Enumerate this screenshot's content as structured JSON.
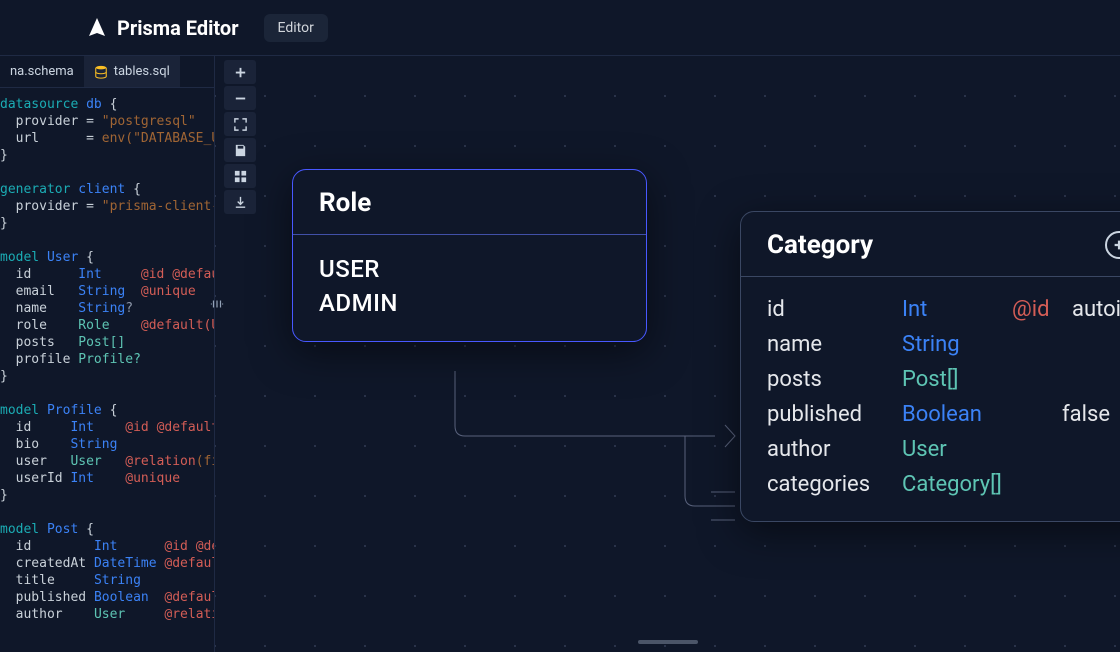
{
  "header": {
    "app_name": "Prisma Editor",
    "editor_button": "Editor"
  },
  "tabs": {
    "schema_label": "na.schema",
    "sql_label": "tables.sql"
  },
  "code": {
    "datasource_kw": "datasource",
    "db_name": "db",
    "provider_lbl": "provider",
    "eq": "=",
    "pg_str": "\"postgresql\"",
    "url_lbl": "url",
    "env_str": "env(\"DATABASE_URL\")",
    "generator_kw": "generator",
    "client_name": "client",
    "prisma_client_str": "\"prisma-client-js\"",
    "model_kw": "model",
    "user_name": "User",
    "profile_name": "Profile",
    "post_name": "Post",
    "id_f": "id",
    "int_t": "Int",
    "id_attr": "@id",
    "default_attr": "@default",
    "default_trunc": "@default(au",
    "default_role": "@default(USE",
    "unique_attr": "@unique",
    "email_f": "email",
    "string_t": "String",
    "name_f": "name",
    "role_f": "role",
    "role_t": "Role",
    "posts_f": "posts",
    "post_arr": "Post[]",
    "profile_f": "profile",
    "profile_opt": "Profile?",
    "bio_f": "bio",
    "user_f": "user",
    "user_t": "User",
    "relation_attr": "@relation",
    "relation_str": "(field",
    "userid_f": "userId",
    "createdat_f": "createdAt",
    "datetime_t": "DateTime",
    "title_f": "title",
    "published_f": "published",
    "boolean_t": "Boolean",
    "author_f": "author",
    "relati_trunc": "@relati",
    "id_de_trunc": "@id @de",
    "defaul_trunc": "@defaul"
  },
  "role_node": {
    "title": "Role",
    "values": [
      "USER",
      "ADMIN"
    ]
  },
  "category_node": {
    "title": "Category",
    "fields": [
      {
        "name": "id",
        "type": "Int",
        "type_class": "",
        "attr": "@id",
        "val": "autoincrement"
      },
      {
        "name": "name",
        "type": "String",
        "type_class": "",
        "attr": "",
        "val": ""
      },
      {
        "name": "posts",
        "type": "Post[]",
        "type_class": "rel",
        "attr": "",
        "val": ""
      }
    ]
  },
  "extra_fields": {
    "published_name": "published",
    "published_type": "Boolean",
    "published_val": "false",
    "author_name": "author",
    "author_type": "User",
    "categories_name": "categories",
    "categories_type": "Category[]"
  }
}
